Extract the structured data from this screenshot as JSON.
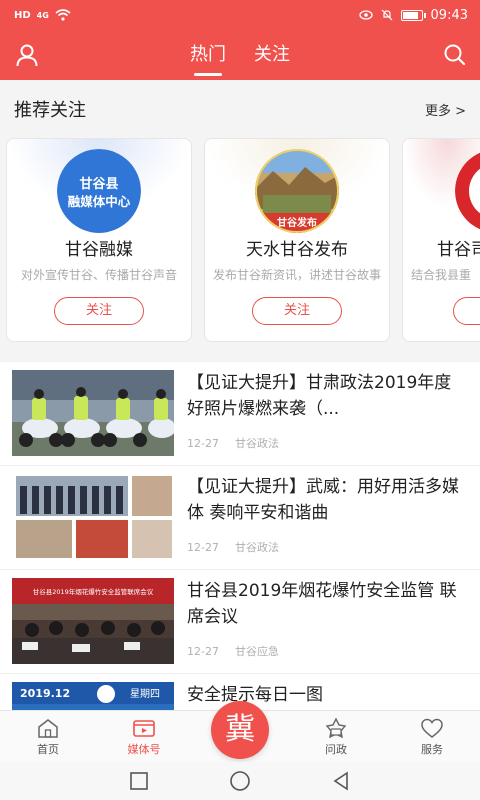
{
  "status": {
    "network": "HD",
    "signal": "4G",
    "time": "09:43"
  },
  "header": {
    "tabs": [
      "热门",
      "关注"
    ],
    "active_tab": 0
  },
  "recommend": {
    "title": "推荐关注",
    "more": "更多 >",
    "cards": [
      {
        "name": "甘谷融媒",
        "desc": "对外宣传甘谷、传播甘谷声音",
        "button": "关注",
        "avatar_line1": "甘谷县",
        "avatar_line2": "融媒体中心"
      },
      {
        "name": "天水甘谷发布",
        "desc": "发布甘谷新资讯，讲述甘谷故事",
        "button": "关注",
        "avatar_label": "甘谷发布"
      },
      {
        "name": "甘谷司",
        "desc": "结合我县重",
        "button": "关"
      }
    ]
  },
  "news": [
    {
      "title": "【见证大提升】甘肃政法2019年度好照片爆燃来袭（...",
      "date": "12-27",
      "source": "甘谷政法"
    },
    {
      "title": "【见证大提升】武威：用好用活多媒体 奏响平安和谐曲",
      "date": "12-27",
      "source": "甘谷政法"
    },
    {
      "title": "甘谷县2019年烟花爆竹安全监管 联席会议",
      "date": "12-27",
      "source": "甘谷应急",
      "thumb_banner": "甘谷县2019年烟花爆竹安全监管联席会议"
    },
    {
      "title": "安全提示每日一图",
      "thumb_date": "2019.12",
      "thumb_weekday": "星期四"
    }
  ],
  "bottom_nav": {
    "items": [
      {
        "label": "首页",
        "icon": "home-icon"
      },
      {
        "label": "媒体号",
        "icon": "video-icon"
      },
      {
        "label": "问政",
        "icon": "ask-icon"
      },
      {
        "label": "服务",
        "icon": "heart-icon"
      }
    ],
    "center": "冀",
    "active": 1
  },
  "colors": {
    "primary": "#f0514c",
    "muted": "#b0b0b0"
  }
}
